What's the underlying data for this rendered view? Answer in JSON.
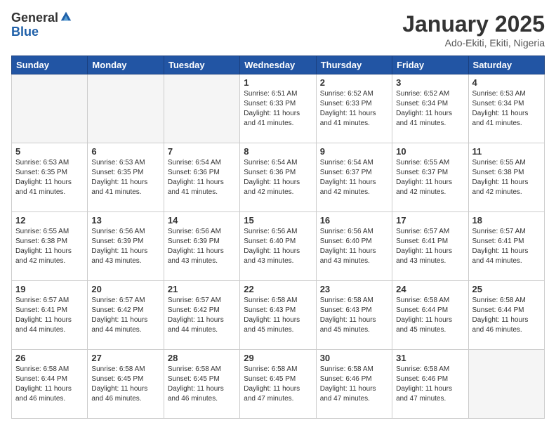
{
  "logo": {
    "general": "General",
    "blue": "Blue"
  },
  "title": {
    "month": "January 2025",
    "location": "Ado-Ekiti, Ekiti, Nigeria"
  },
  "headers": [
    "Sunday",
    "Monday",
    "Tuesday",
    "Wednesday",
    "Thursday",
    "Friday",
    "Saturday"
  ],
  "weeks": [
    [
      {
        "num": "",
        "detail": ""
      },
      {
        "num": "",
        "detail": ""
      },
      {
        "num": "",
        "detail": ""
      },
      {
        "num": "1",
        "detail": "Sunrise: 6:51 AM\nSunset: 6:33 PM\nDaylight: 11 hours\nand 41 minutes."
      },
      {
        "num": "2",
        "detail": "Sunrise: 6:52 AM\nSunset: 6:33 PM\nDaylight: 11 hours\nand 41 minutes."
      },
      {
        "num": "3",
        "detail": "Sunrise: 6:52 AM\nSunset: 6:34 PM\nDaylight: 11 hours\nand 41 minutes."
      },
      {
        "num": "4",
        "detail": "Sunrise: 6:53 AM\nSunset: 6:34 PM\nDaylight: 11 hours\nand 41 minutes."
      }
    ],
    [
      {
        "num": "5",
        "detail": "Sunrise: 6:53 AM\nSunset: 6:35 PM\nDaylight: 11 hours\nand 41 minutes."
      },
      {
        "num": "6",
        "detail": "Sunrise: 6:53 AM\nSunset: 6:35 PM\nDaylight: 11 hours\nand 41 minutes."
      },
      {
        "num": "7",
        "detail": "Sunrise: 6:54 AM\nSunset: 6:36 PM\nDaylight: 11 hours\nand 41 minutes."
      },
      {
        "num": "8",
        "detail": "Sunrise: 6:54 AM\nSunset: 6:36 PM\nDaylight: 11 hours\nand 42 minutes."
      },
      {
        "num": "9",
        "detail": "Sunrise: 6:54 AM\nSunset: 6:37 PM\nDaylight: 11 hours\nand 42 minutes."
      },
      {
        "num": "10",
        "detail": "Sunrise: 6:55 AM\nSunset: 6:37 PM\nDaylight: 11 hours\nand 42 minutes."
      },
      {
        "num": "11",
        "detail": "Sunrise: 6:55 AM\nSunset: 6:38 PM\nDaylight: 11 hours\nand 42 minutes."
      }
    ],
    [
      {
        "num": "12",
        "detail": "Sunrise: 6:55 AM\nSunset: 6:38 PM\nDaylight: 11 hours\nand 42 minutes."
      },
      {
        "num": "13",
        "detail": "Sunrise: 6:56 AM\nSunset: 6:39 PM\nDaylight: 11 hours\nand 43 minutes."
      },
      {
        "num": "14",
        "detail": "Sunrise: 6:56 AM\nSunset: 6:39 PM\nDaylight: 11 hours\nand 43 minutes."
      },
      {
        "num": "15",
        "detail": "Sunrise: 6:56 AM\nSunset: 6:40 PM\nDaylight: 11 hours\nand 43 minutes."
      },
      {
        "num": "16",
        "detail": "Sunrise: 6:56 AM\nSunset: 6:40 PM\nDaylight: 11 hours\nand 43 minutes."
      },
      {
        "num": "17",
        "detail": "Sunrise: 6:57 AM\nSunset: 6:41 PM\nDaylight: 11 hours\nand 43 minutes."
      },
      {
        "num": "18",
        "detail": "Sunrise: 6:57 AM\nSunset: 6:41 PM\nDaylight: 11 hours\nand 44 minutes."
      }
    ],
    [
      {
        "num": "19",
        "detail": "Sunrise: 6:57 AM\nSunset: 6:41 PM\nDaylight: 11 hours\nand 44 minutes."
      },
      {
        "num": "20",
        "detail": "Sunrise: 6:57 AM\nSunset: 6:42 PM\nDaylight: 11 hours\nand 44 minutes."
      },
      {
        "num": "21",
        "detail": "Sunrise: 6:57 AM\nSunset: 6:42 PM\nDaylight: 11 hours\nand 44 minutes."
      },
      {
        "num": "22",
        "detail": "Sunrise: 6:58 AM\nSunset: 6:43 PM\nDaylight: 11 hours\nand 45 minutes."
      },
      {
        "num": "23",
        "detail": "Sunrise: 6:58 AM\nSunset: 6:43 PM\nDaylight: 11 hours\nand 45 minutes."
      },
      {
        "num": "24",
        "detail": "Sunrise: 6:58 AM\nSunset: 6:44 PM\nDaylight: 11 hours\nand 45 minutes."
      },
      {
        "num": "25",
        "detail": "Sunrise: 6:58 AM\nSunset: 6:44 PM\nDaylight: 11 hours\nand 46 minutes."
      }
    ],
    [
      {
        "num": "26",
        "detail": "Sunrise: 6:58 AM\nSunset: 6:44 PM\nDaylight: 11 hours\nand 46 minutes."
      },
      {
        "num": "27",
        "detail": "Sunrise: 6:58 AM\nSunset: 6:45 PM\nDaylight: 11 hours\nand 46 minutes."
      },
      {
        "num": "28",
        "detail": "Sunrise: 6:58 AM\nSunset: 6:45 PM\nDaylight: 11 hours\nand 46 minutes."
      },
      {
        "num": "29",
        "detail": "Sunrise: 6:58 AM\nSunset: 6:45 PM\nDaylight: 11 hours\nand 47 minutes."
      },
      {
        "num": "30",
        "detail": "Sunrise: 6:58 AM\nSunset: 6:46 PM\nDaylight: 11 hours\nand 47 minutes."
      },
      {
        "num": "31",
        "detail": "Sunrise: 6:58 AM\nSunset: 6:46 PM\nDaylight: 11 hours\nand 47 minutes."
      },
      {
        "num": "",
        "detail": ""
      }
    ]
  ]
}
